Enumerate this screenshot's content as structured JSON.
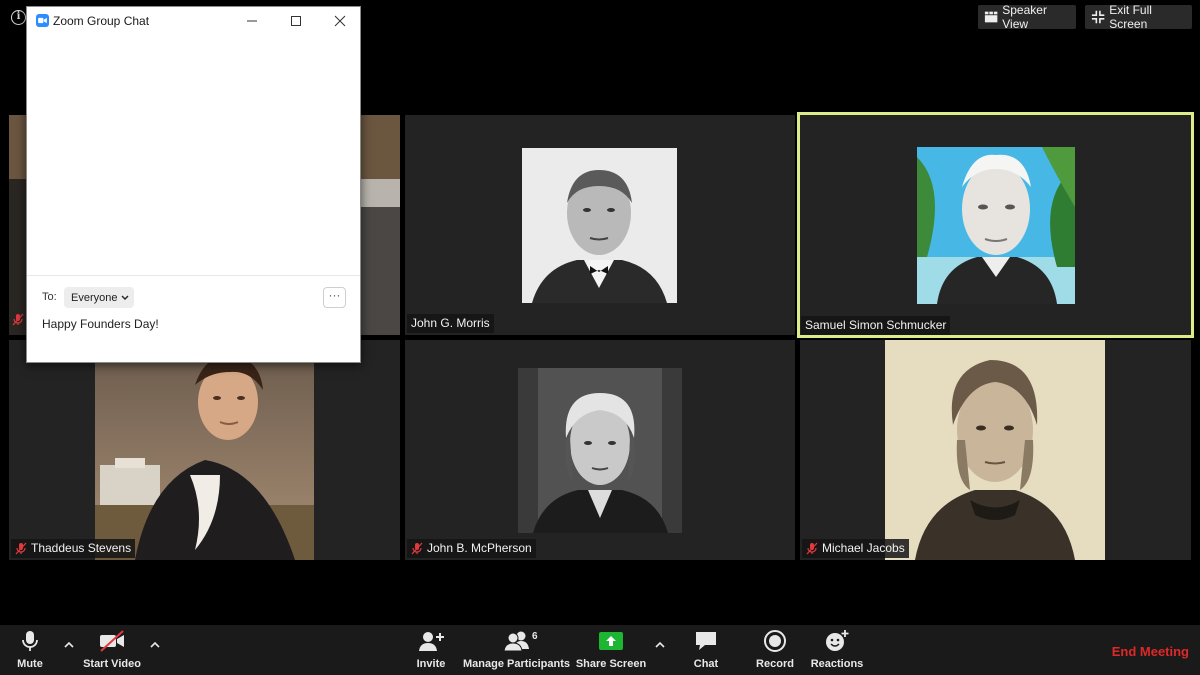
{
  "top_bar": {
    "speaker_view_label": "Speaker View",
    "exit_fullscreen_label": "Exit Full Screen"
  },
  "chat_window": {
    "title": "Zoom Group Chat",
    "to_label": "To:",
    "recipient": "Everyone",
    "more_label": "···",
    "message_text": "Happy Founders Day!"
  },
  "participants": [
    {
      "name": "John G. Morris",
      "muted": false,
      "active": false
    },
    {
      "name": "Samuel Simon Schmucker",
      "muted": false,
      "active": true
    },
    {
      "name": "Thaddeus Stevens",
      "muted": true,
      "active": false
    },
    {
      "name": "John B. McPherson",
      "muted": true,
      "active": false
    },
    {
      "name": "Michael Jacobs",
      "muted": true,
      "active": false
    }
  ],
  "toolbar": {
    "mute_label": "Mute",
    "start_video_label": "Start Video",
    "invite_label": "Invite",
    "manage_participants_label": "Manage Participants",
    "participant_count": "6",
    "share_screen_label": "Share Screen",
    "chat_label": "Chat",
    "record_label": "Record",
    "reactions_label": "Reactions",
    "end_meeting_label": "End Meeting"
  },
  "colors": {
    "active_speaker_border": "#ddeb8a",
    "share_green": "#1db633",
    "end_meeting_red": "#e02828",
    "mute_red": "#e0393e",
    "zoom_blue": "#2d8cff"
  }
}
